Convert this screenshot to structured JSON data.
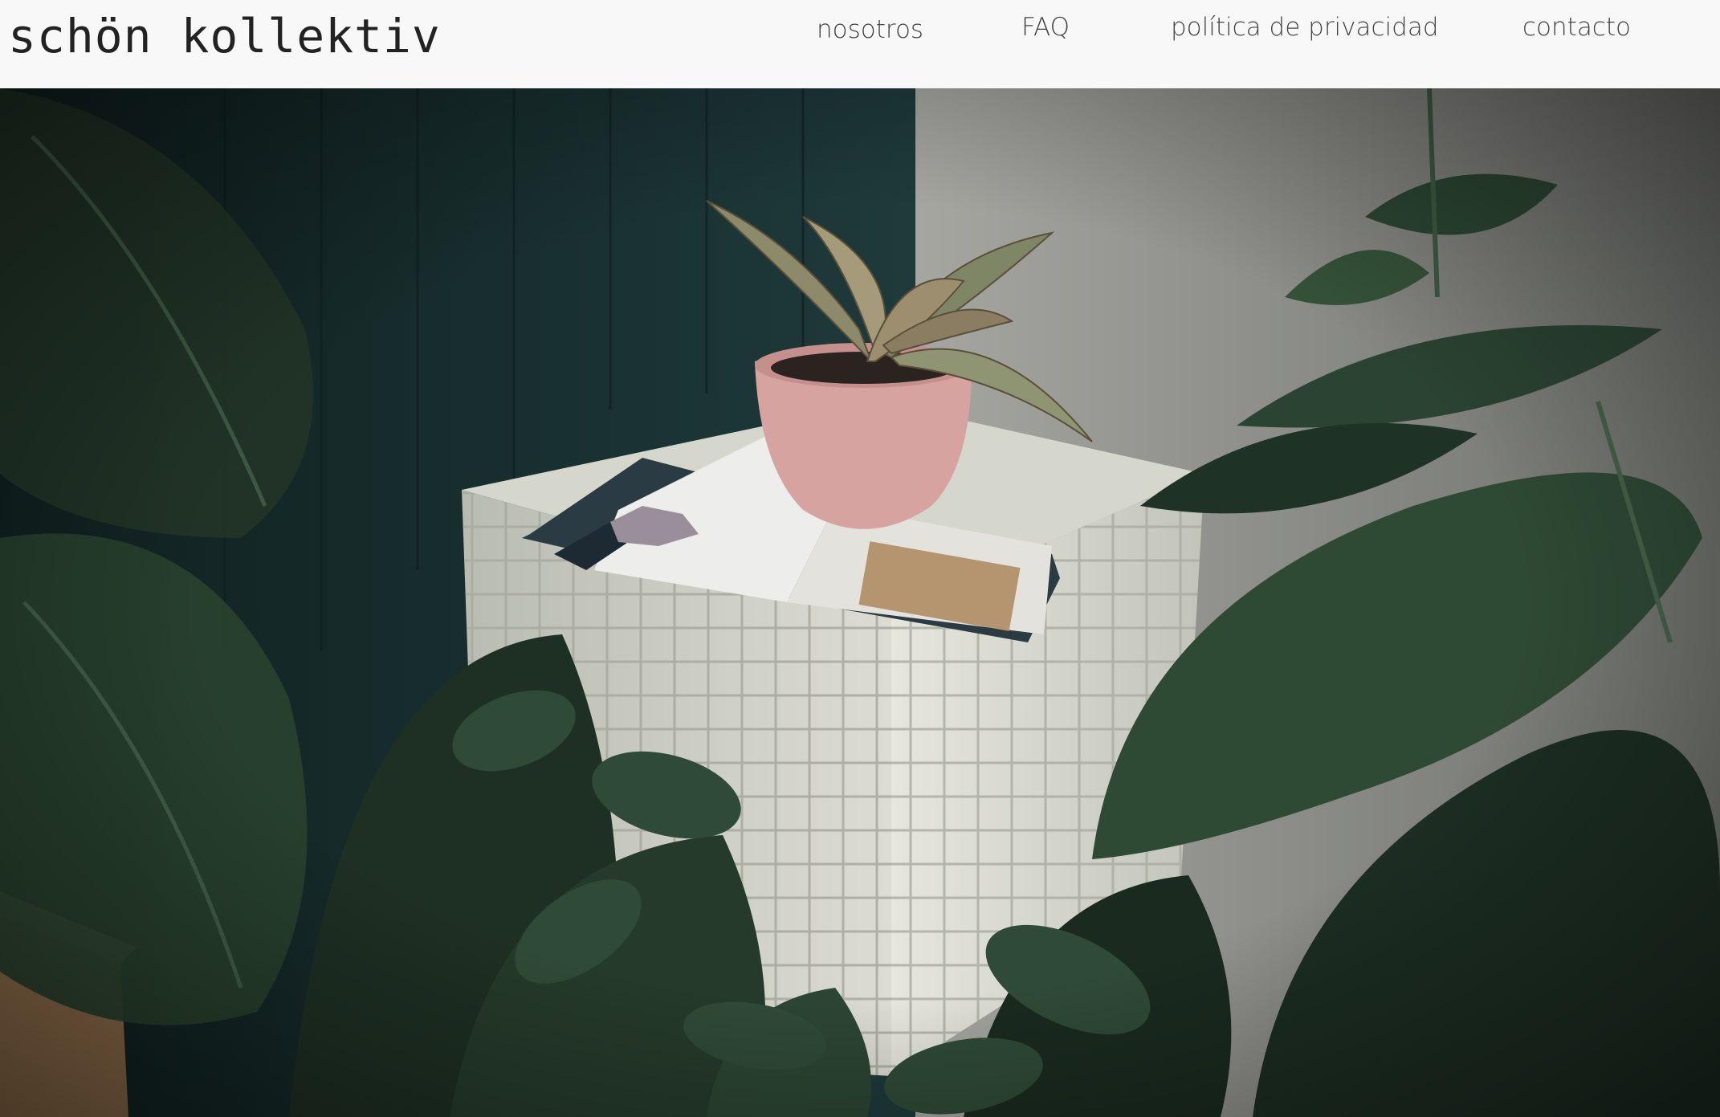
{
  "header": {
    "logo": "schön kollektiv",
    "nav": [
      {
        "label": "nosotros"
      },
      {
        "label": "FAQ"
      },
      {
        "label": "política de privacidad"
      },
      {
        "label": "contacto"
      }
    ]
  },
  "hero": {
    "description_icon": "plant-photo"
  },
  "colors": {
    "header_bg": "#f8f8f8",
    "wall_teal": "#1d3536",
    "wall_grey": "#8a8a86",
    "tile": "#d9dacf",
    "pot": "#d9a7a4",
    "leaf_dark": "#1f2f22",
    "leaf_mid": "#34503a"
  }
}
